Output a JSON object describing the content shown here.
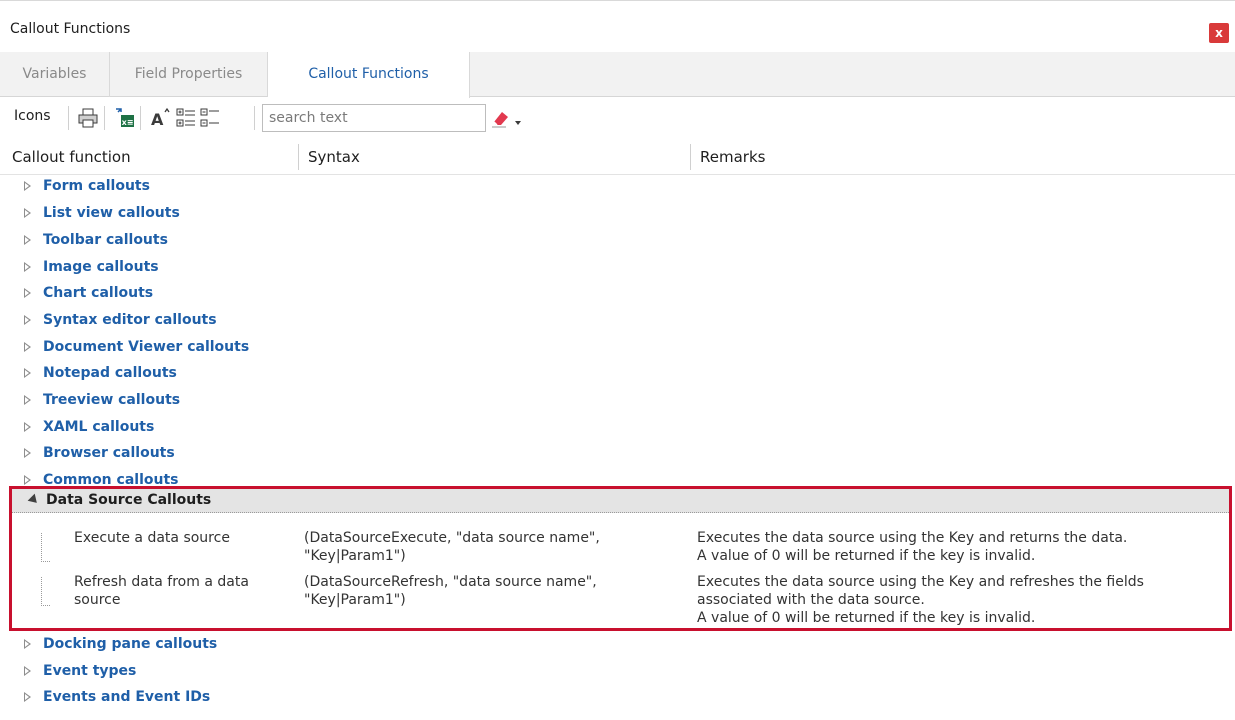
{
  "window": {
    "title": "Callout Functions",
    "close_label": "x"
  },
  "tabs": [
    {
      "label": "Variables",
      "active": false
    },
    {
      "label": "Field Properties",
      "active": false
    },
    {
      "label": "Callout Functions",
      "active": true
    }
  ],
  "toolbar": {
    "icons_label": "Icons",
    "search_placeholder": "search text",
    "icon_names": [
      "print-icon",
      "export-excel-icon",
      "font-size-icon",
      "expand-all-icon",
      "collapse-all-icon",
      "eraser-icon",
      "dropdown-arrow-icon"
    ]
  },
  "columns": {
    "function": "Callout function",
    "syntax": "Syntax",
    "remarks": "Remarks"
  },
  "groups_top": [
    "Form callouts",
    "List view callouts",
    "Toolbar callouts",
    "Image callouts",
    "Chart callouts",
    "Syntax editor callouts",
    "Document Viewer callouts",
    "Notepad callouts",
    "Treeview callouts",
    "XAML callouts",
    "Browser callouts",
    "Common callouts"
  ],
  "expanded_group": {
    "label": "Data Source Callouts",
    "rows": [
      {
        "function": [
          "Execute a data source"
        ],
        "syntax": [
          "(DataSourceExecute, \"data source name\",",
          "\"Key|Param1\")"
        ],
        "remarks": [
          "Executes the data source using the Key and returns the data.",
          "A value of 0 will be returned if the key is invalid."
        ]
      },
      {
        "function": [
          "Refresh data from a data",
          "source"
        ],
        "syntax": [
          "(DataSourceRefresh, \"data source name\",",
          "\"Key|Param1\")"
        ],
        "remarks": [
          "Executes the data source using the Key and refreshes the fields",
          "associated with the data source.",
          "A value of 0 will be returned if the key is invalid."
        ]
      }
    ]
  },
  "groups_bottom": [
    "Docking pane callouts",
    "Event types",
    "Events and Event IDs"
  ],
  "colors": {
    "accent_blue": "#1f5fa8",
    "highlight_red": "#c8102e",
    "close_red": "#d93a3a"
  }
}
